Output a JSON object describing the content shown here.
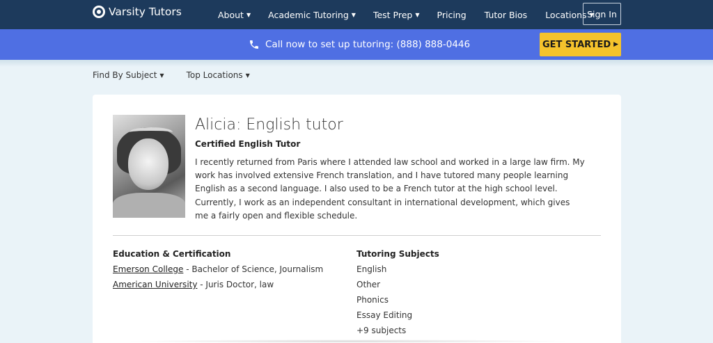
{
  "nav": {
    "logo_text": "Varsity Tutors",
    "items": [
      {
        "label": "About",
        "dropdown": true
      },
      {
        "label": "Academic Tutoring",
        "dropdown": true
      },
      {
        "label": "Test Prep",
        "dropdown": true
      },
      {
        "label": "Pricing",
        "dropdown": false
      },
      {
        "label": "Tutor Bios",
        "dropdown": false
      },
      {
        "label": "Locations",
        "dropdown": true
      }
    ],
    "signin_label": "Sign In"
  },
  "callbar": {
    "text": "Call now to set up tutoring: (888) 888-0446",
    "cta_label": "GET STARTED"
  },
  "subnav": {
    "items": [
      "Find By Subject",
      "Top Locations"
    ]
  },
  "profile": {
    "name": "Alicia: English tutor",
    "subtitle": "Certified English Tutor",
    "bio": "I recently returned from Paris where I attended law school and worked in a large law firm. My work has involved extensive French translation, and I have tutored many people learning English as a second language. I also used to be a French tutor at the high school level. Currently, I work as an independent consultant in international development, which gives me a fairly open and flexible schedule."
  },
  "education": {
    "heading": "Education & Certification",
    "entries": [
      {
        "school": "Emerson College",
        "detail": " - Bachelor of Science, Journalism"
      },
      {
        "school": "American University",
        "detail": " - Juris Doctor, law"
      }
    ]
  },
  "subjects": {
    "heading": "Tutoring Subjects",
    "items": [
      "English",
      "Other",
      "Phonics",
      "Essay Editing",
      "+9 subjects"
    ]
  },
  "colors": {
    "nav_bg": "#1d3a5c",
    "callbar_bg": "#4f6fe3",
    "cta_bg": "#f5c32c",
    "page_bg": "#eaf3f8"
  }
}
